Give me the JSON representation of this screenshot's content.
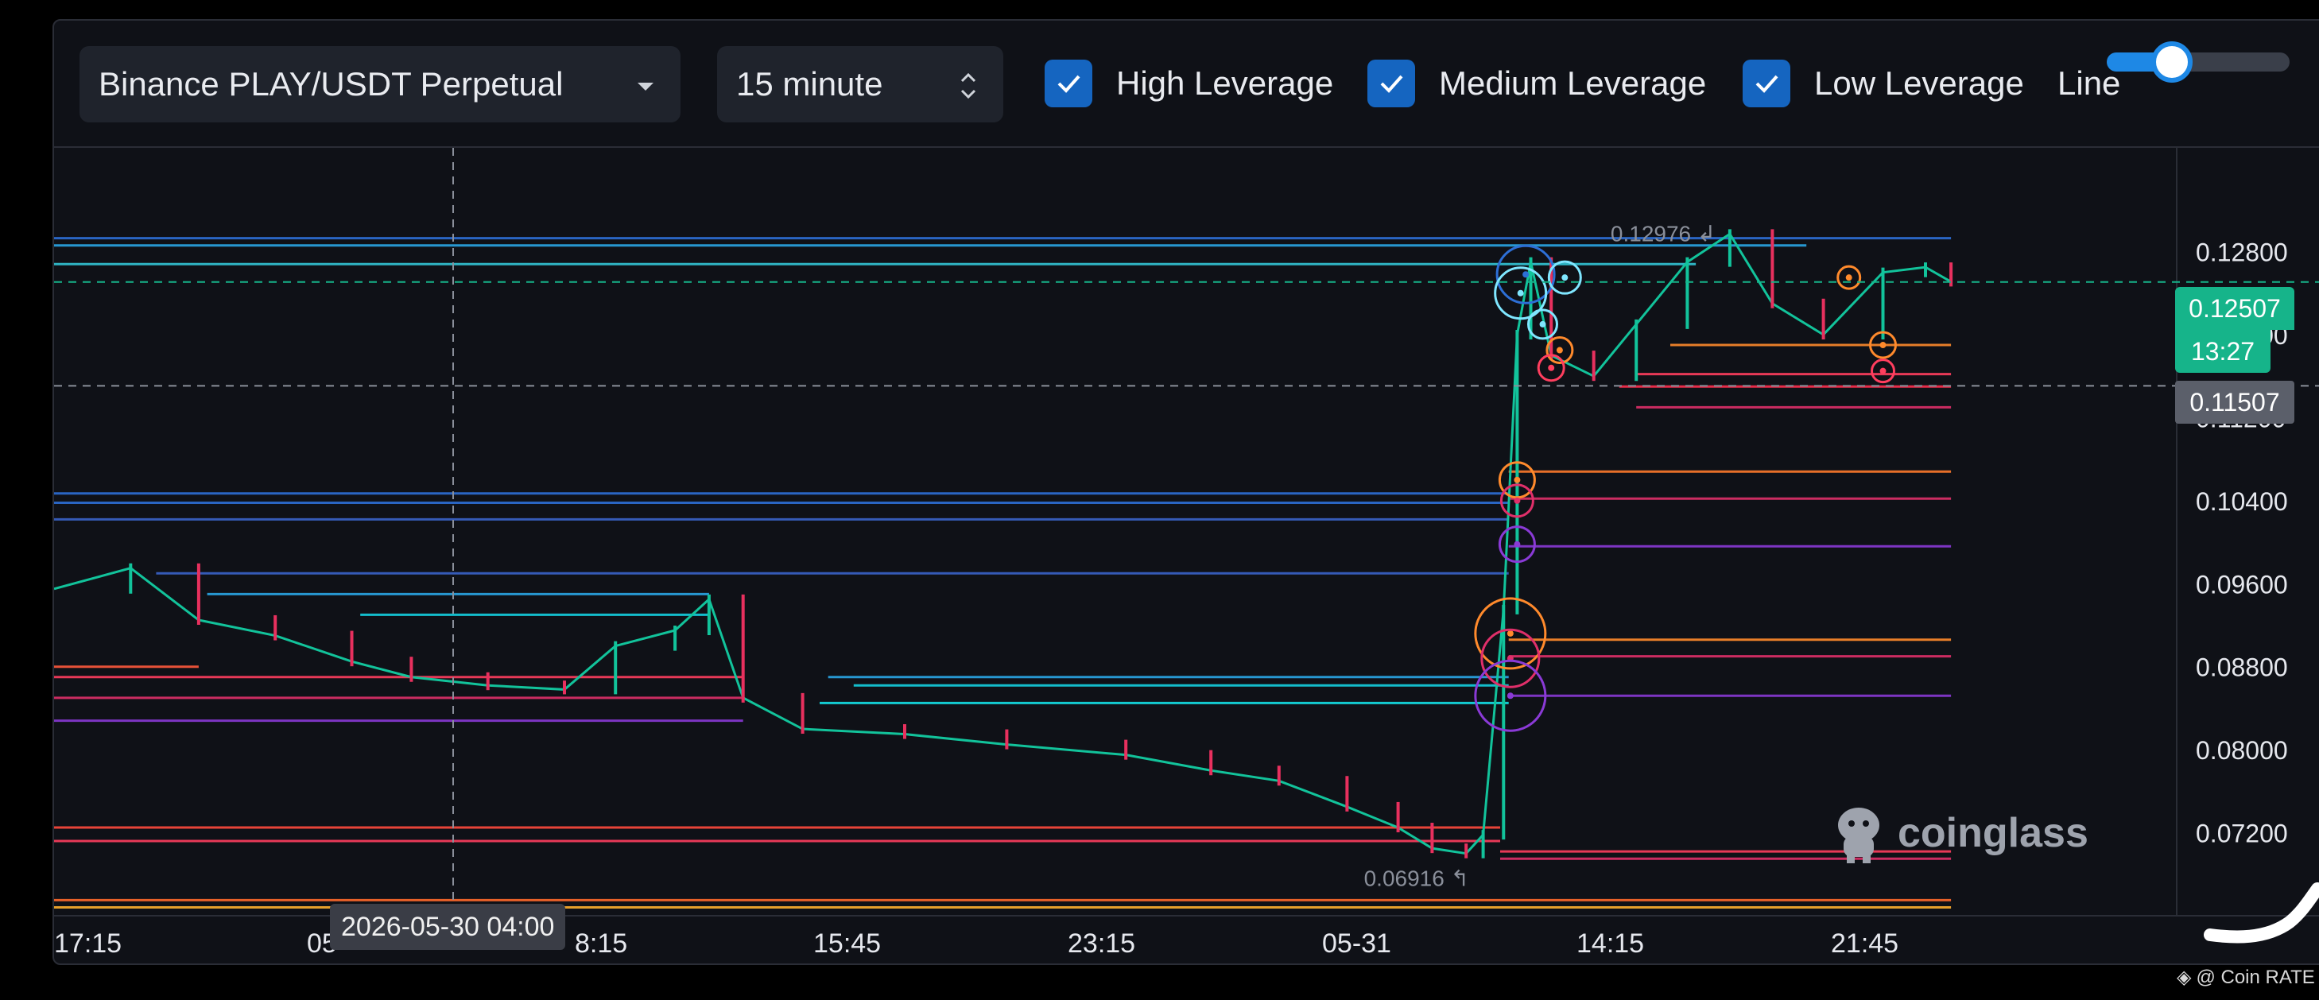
{
  "toolbar": {
    "pair_select": {
      "value": "Binance PLAY/USDT Perpetual",
      "icon": "caret-down-icon"
    },
    "interval_select": {
      "value": "15 minute",
      "icon": "updown-arrows-icon"
    },
    "checkboxes": [
      {
        "label": "High Leverage",
        "checked": true
      },
      {
        "label": "Medium Leverage",
        "checked": true
      },
      {
        "label": "Low Leverage",
        "checked": true
      }
    ],
    "line_label": "Line",
    "line_toggle_on": true
  },
  "price_tags": {
    "current_price": "0.12507",
    "countdown": "13:27",
    "crosshair_price": "0.11507",
    "current_color": "#16b48a",
    "crosshair_color": "#5b5f6a"
  },
  "crosshair_date": "2026-05-30 04:00",
  "annotations": {
    "high": "0.12976",
    "low": "0.06916"
  },
  "watermark": "coinglass",
  "footer_credit": "@ Coin RATE",
  "colors": {
    "background": "#0f1117",
    "accent": "#1565c0",
    "up": "#12c39b",
    "down": "#e8305e"
  },
  "chart_data": {
    "type": "line",
    "yaxis_ticks": [
      "0.12800",
      "0.12000",
      "0.11200",
      "0.10400",
      "0.09600",
      "0.08800",
      "0.08000",
      "0.07200"
    ],
    "xaxis_ticks": [
      "17:15",
      "05",
      "8:15",
      "15:45",
      "23:15",
      "05-31",
      "14:15",
      "21:45"
    ],
    "ylim": [
      0.064,
      0.138
    ],
    "price_path": [
      [
        0,
        0.0955
      ],
      [
        45,
        0.0975
      ],
      [
        85,
        0.0925
      ],
      [
        130,
        0.091
      ],
      [
        175,
        0.0885
      ],
      [
        210,
        0.087
      ],
      [
        255,
        0.0862
      ],
      [
        300,
        0.0858
      ],
      [
        330,
        0.09
      ],
      [
        365,
        0.0915
      ],
      [
        385,
        0.0945
      ],
      [
        405,
        0.085
      ],
      [
        440,
        0.082
      ],
      [
        500,
        0.0815
      ],
      [
        560,
        0.0805
      ],
      [
        630,
        0.0795
      ],
      [
        680,
        0.078
      ],
      [
        720,
        0.077
      ],
      [
        760,
        0.0745
      ],
      [
        790,
        0.0725
      ],
      [
        810,
        0.0705
      ],
      [
        830,
        0.07
      ],
      [
        840,
        0.0718
      ],
      [
        852,
        0.0935
      ],
      [
        860,
        0.12
      ],
      [
        868,
        0.127
      ],
      [
        880,
        0.118
      ],
      [
        905,
        0.116
      ],
      [
        930,
        0.121
      ],
      [
        960,
        0.127
      ],
      [
        985,
        0.1297
      ],
      [
        1010,
        0.123
      ],
      [
        1040,
        0.12
      ],
      [
        1075,
        0.126
      ],
      [
        1100,
        0.1265
      ],
      [
        1115,
        0.1251
      ]
    ],
    "liquidation_levels": [
      {
        "price": 0.1293,
        "start": 0,
        "end": 1115,
        "color": "#2d6fd6"
      },
      {
        "price": 0.1286,
        "start": 0,
        "end": 1030,
        "color": "#2aa6e6"
      },
      {
        "price": 0.1268,
        "start": 0,
        "end": 965,
        "color": "#33c6d6"
      },
      {
        "price": 0.1047,
        "start": 0,
        "end": 855,
        "color": "#2d6fd6"
      },
      {
        "price": 0.1038,
        "start": 0,
        "end": 855,
        "color": "#2d6fd6"
      },
      {
        "price": 0.1022,
        "start": 0,
        "end": 855,
        "color": "#3a63c9"
      },
      {
        "price": 0.097,
        "start": 60,
        "end": 855,
        "color": "#3a63c9"
      },
      {
        "price": 0.095,
        "start": 90,
        "end": 385,
        "color": "#2aa6e6"
      },
      {
        "price": 0.093,
        "start": 180,
        "end": 385,
        "color": "#14d0e0"
      },
      {
        "price": 0.088,
        "start": 0,
        "end": 85,
        "color": "#ff5a3c"
      },
      {
        "price": 0.087,
        "start": 0,
        "end": 405,
        "color": "#ff3e5e"
      },
      {
        "price": 0.085,
        "start": 0,
        "end": 405,
        "color": "#e02f6a"
      },
      {
        "price": 0.0828,
        "start": 0,
        "end": 405,
        "color": "#8a3ad6"
      },
      {
        "price": 0.087,
        "start": 455,
        "end": 855,
        "color": "#2aa6e6"
      },
      {
        "price": 0.0862,
        "start": 470,
        "end": 855,
        "color": "#14d0e0"
      },
      {
        "price": 0.0845,
        "start": 450,
        "end": 855,
        "color": "#14e0e6"
      },
      {
        "price": 0.0725,
        "start": 0,
        "end": 850,
        "color": "#ff4a3c"
      },
      {
        "price": 0.0712,
        "start": 0,
        "end": 850,
        "color": "#ff3e5e"
      },
      {
        "price": 0.0702,
        "start": 850,
        "end": 1115,
        "color": "#ff3e5e"
      },
      {
        "price": 0.0695,
        "start": 850,
        "end": 1115,
        "color": "#e02f6a"
      },
      {
        "price": 0.0655,
        "start": 0,
        "end": 1115,
        "color": "#ff6a2c"
      },
      {
        "price": 0.0648,
        "start": 0,
        "end": 1115,
        "color": "#ffb02e"
      },
      {
        "price": 0.1068,
        "start": 855,
        "end": 1115,
        "color": "#ff7a2c"
      },
      {
        "price": 0.1042,
        "start": 855,
        "end": 1115,
        "color": "#e02f6a"
      },
      {
        "price": 0.0996,
        "start": 855,
        "end": 1115,
        "color": "#8a3ad6"
      },
      {
        "price": 0.0906,
        "start": 855,
        "end": 1115,
        "color": "#ff8a2c"
      },
      {
        "price": 0.089,
        "start": 855,
        "end": 1115,
        "color": "#e02f6a"
      },
      {
        "price": 0.0852,
        "start": 855,
        "end": 1115,
        "color": "#8a3ad6"
      },
      {
        "price": 0.119,
        "start": 950,
        "end": 1115,
        "color": "#ff8a2c"
      },
      {
        "price": 0.1162,
        "start": 930,
        "end": 1115,
        "color": "#ff3e5e"
      },
      {
        "price": 0.115,
        "start": 920,
        "end": 1115,
        "color": "#ff2e4e"
      },
      {
        "price": 0.113,
        "start": 930,
        "end": 1115,
        "color": "#e02f6a"
      }
    ],
    "bubbles": [
      {
        "price": 0.1258,
        "x": 865,
        "r": 18,
        "color": "#2d6fd6"
      },
      {
        "price": 0.124,
        "x": 862,
        "r": 16,
        "color": "#7fe6ff"
      },
      {
        "price": 0.1255,
        "x": 888,
        "r": 10,
        "color": "#7fe6ff"
      },
      {
        "price": 0.121,
        "x": 875,
        "r": 9,
        "color": "#7fe6ff"
      },
      {
        "price": 0.1185,
        "x": 885,
        "r": 8,
        "color": "#ff8a2c"
      },
      {
        "price": 0.1168,
        "x": 880,
        "r": 8,
        "color": "#ff3e5e"
      },
      {
        "price": 0.106,
        "x": 860,
        "r": 11,
        "color": "#ff8a2c"
      },
      {
        "price": 0.104,
        "x": 860,
        "r": 10,
        "color": "#e02f6a"
      },
      {
        "price": 0.0998,
        "x": 860,
        "r": 11,
        "color": "#8a3ad6"
      },
      {
        "price": 0.0912,
        "x": 856,
        "r": 22,
        "color": "#ff8a2c"
      },
      {
        "price": 0.0888,
        "x": 856,
        "r": 18,
        "color": "#e02f6a"
      },
      {
        "price": 0.0852,
        "x": 856,
        "r": 22,
        "color": "#8a3ad6"
      },
      {
        "price": 0.119,
        "x": 1075,
        "r": 8,
        "color": "#ff8a2c"
      },
      {
        "price": 0.1165,
        "x": 1075,
        "r": 7,
        "color": "#ff3e5e"
      },
      {
        "price": 0.1255,
        "x": 1055,
        "r": 7,
        "color": "#ff8a2c"
      }
    ]
  }
}
